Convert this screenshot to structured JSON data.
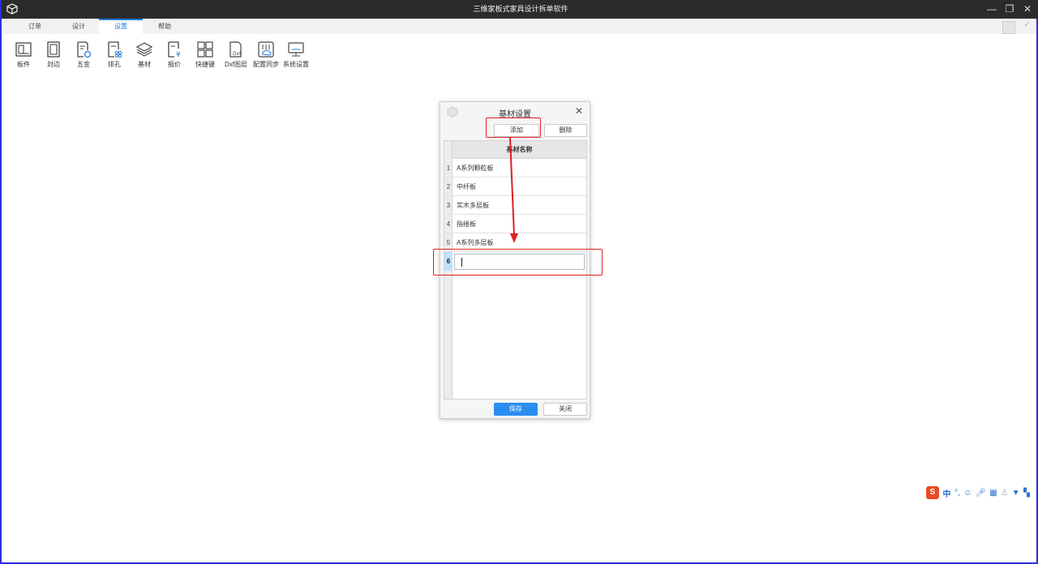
{
  "window": {
    "title": "三维家板式家具设计拆单软件",
    "controls": {
      "minimize": "—",
      "restore": "❐",
      "close": "✕"
    }
  },
  "tabs": [
    {
      "label": "订单"
    },
    {
      "label": "设计"
    },
    {
      "label": "设置",
      "active": true
    },
    {
      "label": "帮助"
    }
  ],
  "toolbar": {
    "items": [
      {
        "label": "板件",
        "icon": "board-icon"
      },
      {
        "label": "封边",
        "icon": "edge-banding-icon"
      },
      {
        "label": "五金",
        "icon": "hardware-icon"
      },
      {
        "label": "排孔",
        "icon": "hole-layout-icon"
      },
      {
        "label": "基材",
        "icon": "layers-icon"
      },
      {
        "label": "报价",
        "icon": "quote-icon"
      },
      {
        "label": "快捷键",
        "icon": "shortcut-grid-icon"
      },
      {
        "label": "Dxf图层",
        "icon": "dxf-icon"
      },
      {
        "label": "配置同步",
        "icon": "sync-config-icon"
      },
      {
        "label": "系统设置",
        "icon": "monitor-icon"
      }
    ],
    "dxf_icon_text": "Dxf"
  },
  "dialog": {
    "title": "基材设置",
    "close_glyph": "✕",
    "add_label": "添加",
    "delete_label": "删除",
    "column_header": "基材名称",
    "rows": [
      {
        "num": "1",
        "name": "A系列颗粒板"
      },
      {
        "num": "2",
        "name": "中纤板"
      },
      {
        "num": "3",
        "name": "实木多层板"
      },
      {
        "num": "4",
        "name": "指接板"
      },
      {
        "num": "5",
        "name": "A系列多层板"
      },
      {
        "num": "6",
        "name": ""
      }
    ],
    "save_label": "保存",
    "close_label": "关闭"
  },
  "ime_bar": {
    "logo": "S",
    "mode": "中",
    "punct": "°,",
    "icons": [
      "smile-icon",
      "mic-icon",
      "keyboard-icon",
      "user-icon",
      "shirt-icon",
      "grid-icon"
    ]
  },
  "colors": {
    "accent": "#1f7ed6",
    "primary_button": "#2a8ef0",
    "annotation_red": "#e02020",
    "titlebar": "#2b2b2b"
  }
}
